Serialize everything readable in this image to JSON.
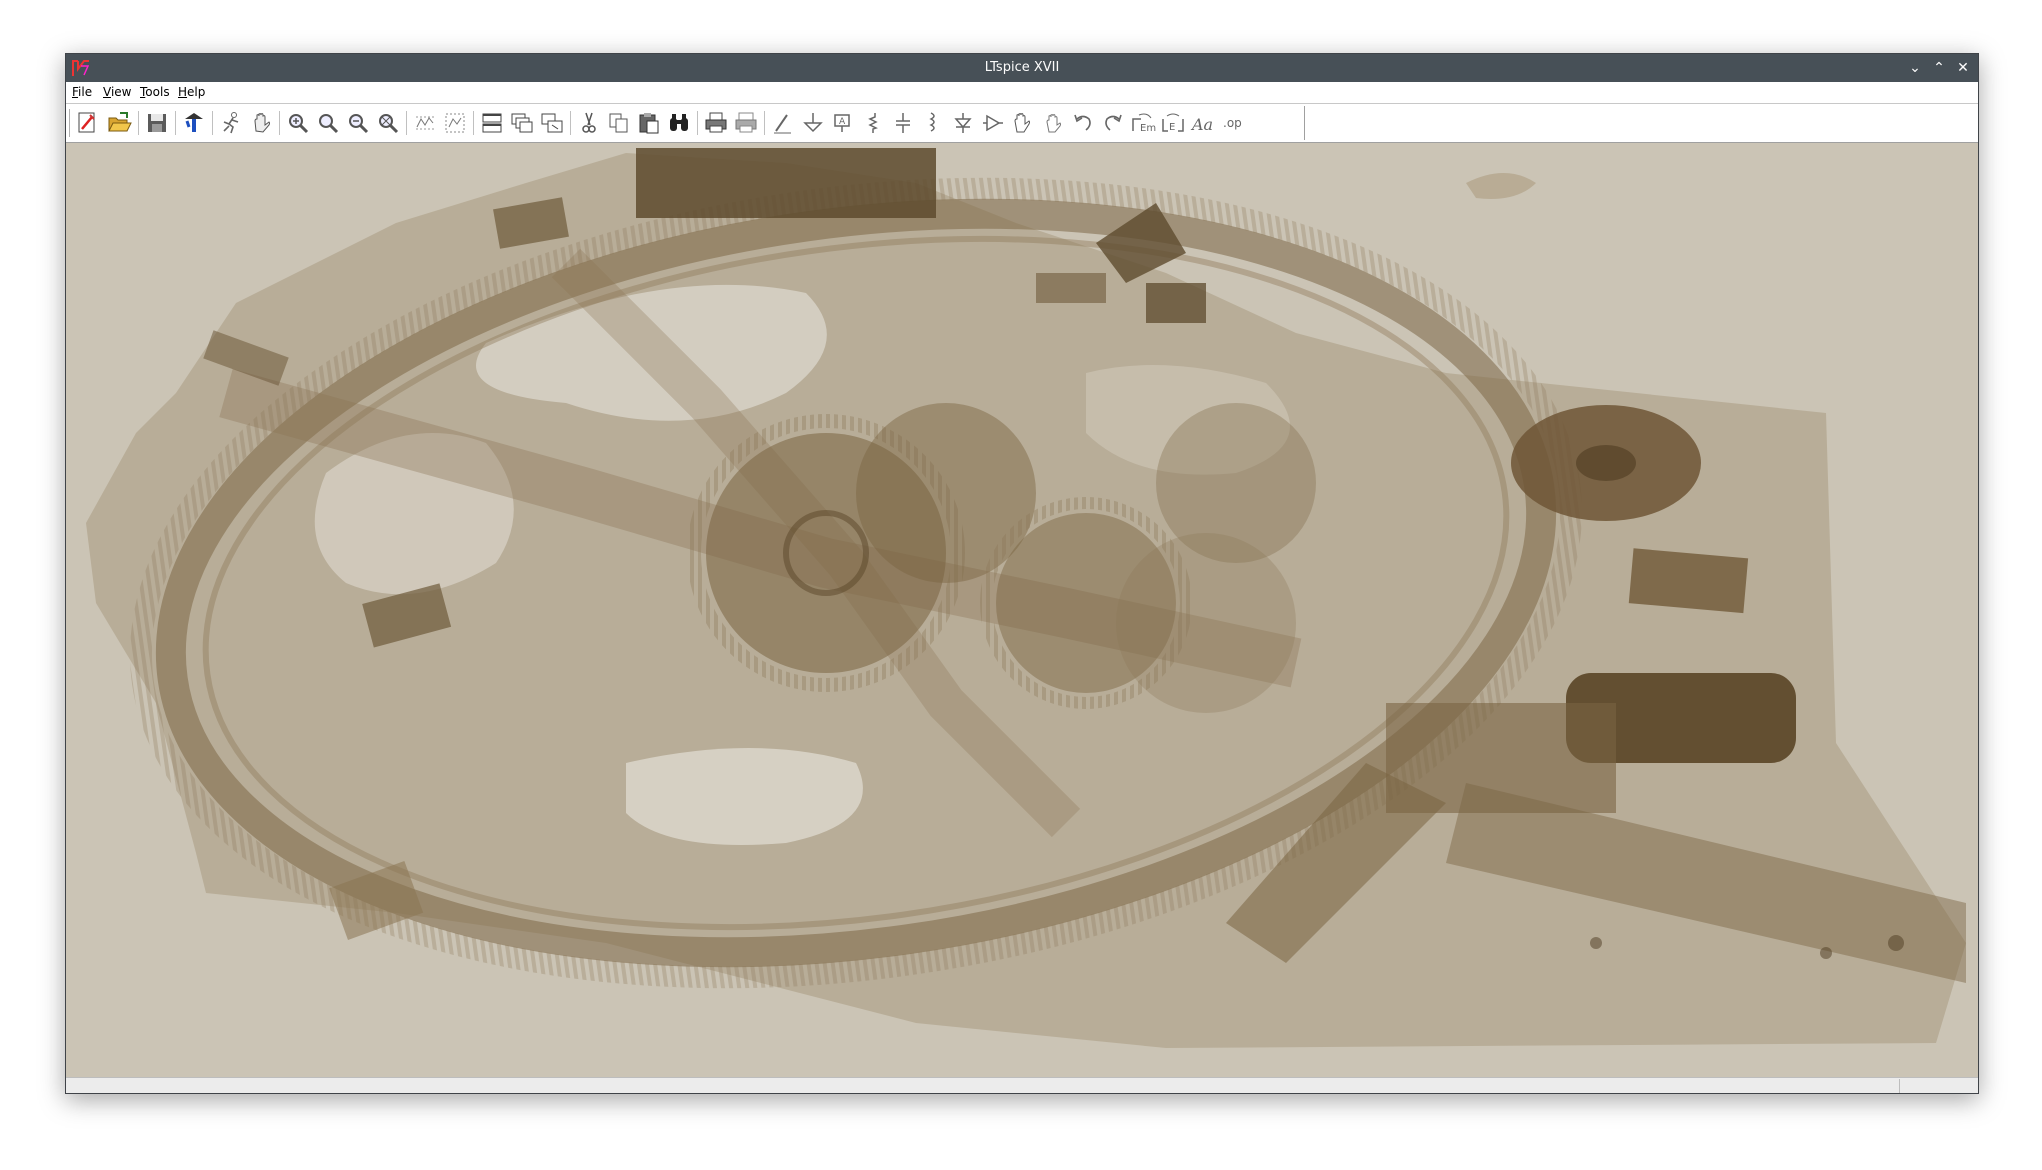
{
  "window": {
    "title": "LTspice XVII"
  },
  "menu": {
    "items": [
      {
        "mnemonic": "F",
        "rest": "ile"
      },
      {
        "mnemonic": "V",
        "rest": "iew"
      },
      {
        "mnemonic": "T",
        "rest": "ools"
      },
      {
        "mnemonic": "H",
        "rest": "elp"
      }
    ]
  },
  "toolbar": {
    "buttons": [
      "new-schematic-icon",
      "open-icon",
      "save-icon",
      "control-panel-icon",
      "run-icon",
      "halt-icon",
      "zoom-area-icon",
      "pan-icon",
      "zoom-back-icon",
      "zoom-fit-icon",
      "autorange-y-icon",
      "view-fit-icon",
      "tile-horizontal-icon",
      "cascade-icon",
      "tile-vertical-icon",
      "cut-icon",
      "copy-icon",
      "paste-icon",
      "find-icon",
      "print-icon",
      "print-preview-icon",
      "draw-wire-icon",
      "ground-icon",
      "label-net-icon",
      "resistor-icon",
      "capacitor-icon",
      "inductor-icon",
      "diode-icon",
      "component-icon",
      "move-icon",
      "drag-icon",
      "undo-icon",
      "redo-icon",
      "rotate-icon",
      "mirror-icon",
      "text-icon",
      "spice-directive-icon"
    ]
  },
  "canvas": {
    "background": "#cbc4b5",
    "image_tint": "#6b5436"
  }
}
